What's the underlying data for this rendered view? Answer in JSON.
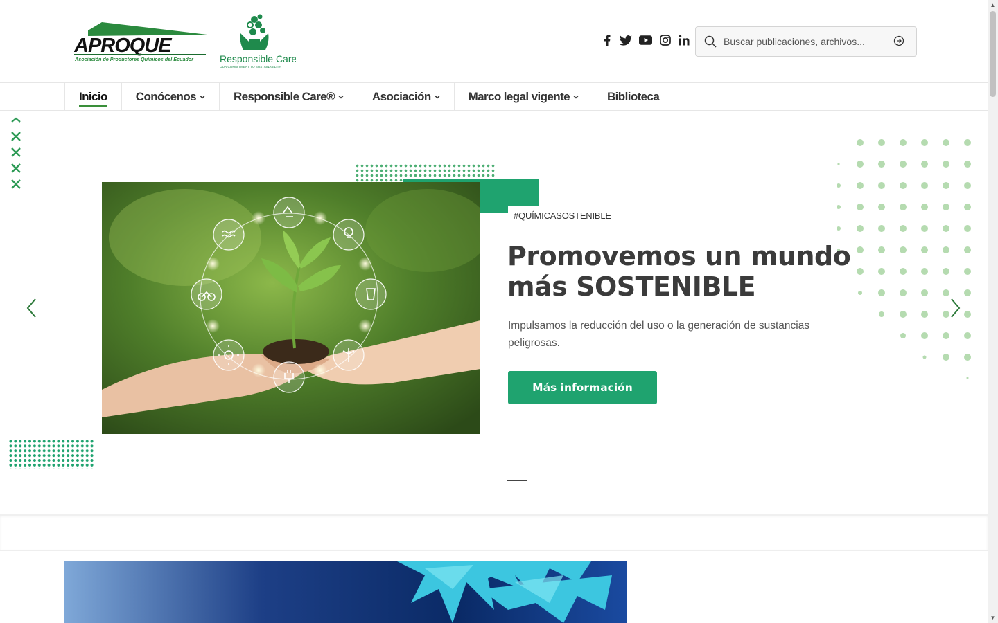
{
  "header": {
    "logo_aproque": {
      "name": "APROQUE",
      "subtitle": "Asociación de Productores Químicos del Ecuador"
    },
    "logo_responsible_care": {
      "name": "Responsible Care",
      "tagline": "OUR COMMITMENT TO SUSTAINABILITY"
    },
    "socials": [
      "facebook-icon",
      "twitter-icon",
      "youtube-icon",
      "instagram-icon",
      "linkedin-icon"
    ],
    "search": {
      "placeholder": "Buscar publicaciones, archivos..."
    }
  },
  "nav": {
    "items": [
      {
        "label": "Inicio",
        "active": true,
        "dropdown": false
      },
      {
        "label": "Conócenos",
        "dropdown": true
      },
      {
        "label": "Responsible Care®",
        "dropdown": true
      },
      {
        "label": "Asociación",
        "dropdown": true
      },
      {
        "label": "Marco legal vigente",
        "dropdown": true
      },
      {
        "label": "Biblioteca",
        "dropdown": false
      }
    ]
  },
  "hero": {
    "tag": "#QUÍMICASOSTENIBLE",
    "title": "Promovemos un mundo más SOSTENIBLE",
    "description": "Impulsamos la reducción del uso o la generación de sustancias peligrosas.",
    "cta_label": "Más información"
  },
  "colors": {
    "brand_green": "#1fa36f",
    "nav_accent": "#3a8f3a",
    "title_text": "#3b3b3b"
  }
}
